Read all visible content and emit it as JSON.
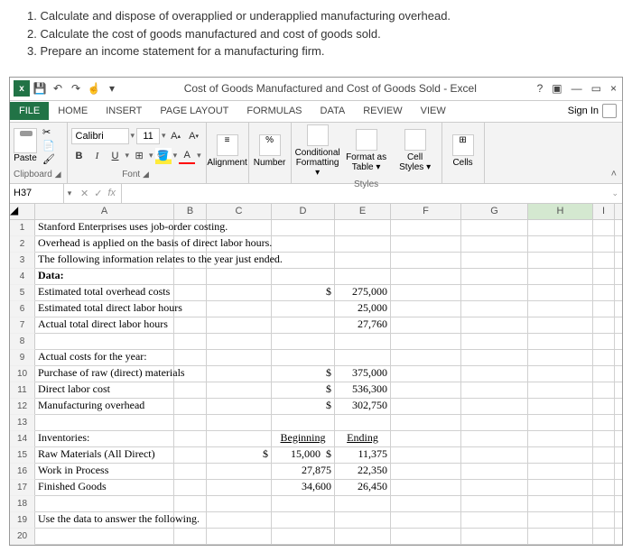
{
  "instructions": {
    "line1": "1. Calculate and dispose of overapplied or underapplied manufacturing overhead.",
    "line2": "2. Calculate the cost of goods manufactured and cost of goods sold.",
    "line3": "3. Prepare an income statement for a manufacturing firm."
  },
  "title": "Cost of Goods Manufactured and Cost of Goods Sold - Excel",
  "window_controls": {
    "help": "?",
    "ribbon_opts": "▣",
    "min": "—",
    "restore": "▭",
    "close": "×"
  },
  "tabs": [
    "FILE",
    "HOME",
    "INSERT",
    "PAGE LAYOUT",
    "FORMULAS",
    "DATA",
    "REVIEW",
    "VIEW"
  ],
  "sign_in": "Sign In",
  "ribbon": {
    "font_name": "Calibri",
    "font_size": "11",
    "groups": {
      "clipboard": "Clipboard",
      "font": "Font",
      "alignment": "Alignment",
      "number": "Number",
      "styles": "Styles",
      "cells": "Cells"
    },
    "paste": "Paste",
    "conditional": "Conditional Formatting",
    "format_as": "Format as Table",
    "cell_styles": "Cell Styles",
    "cells_btn": "Cells"
  },
  "name_box": "H37",
  "fx": "fx",
  "columns": [
    "A",
    "B",
    "C",
    "D",
    "E",
    "F",
    "G",
    "H",
    "I"
  ],
  "rows": {
    "r1": "Stanford Enterprises uses job-order costing.",
    "r2": "Overhead is applied on the basis of direct labor hours.",
    "r3": "The following information relates to the year just ended.",
    "r4": "Data:",
    "r5": {
      "a": "Estimated total overhead costs",
      "d": "$",
      "e": "275,000"
    },
    "r6": {
      "a": "Estimated total direct labor hours",
      "e": "25,000"
    },
    "r7": {
      "a": "Actual total direct labor hours",
      "e": "27,760"
    },
    "r9": "Actual costs for the year:",
    "r10": {
      "a": "  Purchase of raw (direct) materials",
      "d": "$",
      "e": "375,000"
    },
    "r11": {
      "a": "  Direct labor cost",
      "d": "$",
      "e": "536,300"
    },
    "r12": {
      "a": "  Manufacturing overhead",
      "d": "$",
      "e": "302,750"
    },
    "r14": {
      "a": "Inventories:",
      "d": "Beginning",
      "e": "Ending"
    },
    "r15": {
      "a": "  Raw Materials (All Direct)",
      "c": "$",
      "d": "15,000",
      "ds": "$",
      "e": "11,375"
    },
    "r16": {
      "a": "  Work in Process",
      "d": "27,875",
      "e": "22,350"
    },
    "r17": {
      "a": "  Finished Goods",
      "d": "34,600",
      "e": "26,450"
    },
    "r19": "Use the data to answer the following."
  }
}
